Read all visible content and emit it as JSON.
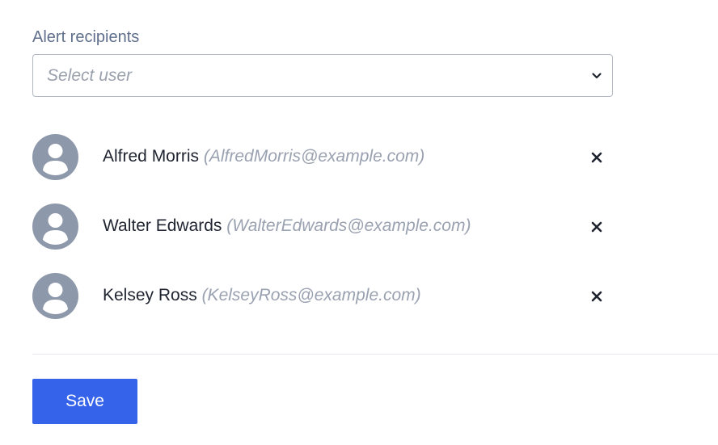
{
  "form": {
    "label": "Alert recipients",
    "select": {
      "placeholder": "Select user",
      "icon": "chevron-down-icon"
    },
    "recipients": [
      {
        "name": "Alfred Morris",
        "email": "(AlfredMorris@example.com)"
      },
      {
        "name": "Walter Edwards",
        "email": "(WalterEdwards@example.com)"
      },
      {
        "name": "Kelsey Ross",
        "email": "(KelseyRoss@example.com)"
      }
    ],
    "remove_icon": "close-icon",
    "avatar_icon": "user-avatar-icon"
  },
  "actions": {
    "save_label": "Save"
  },
  "colors": {
    "primary": "#3563e9",
    "label": "#5f6f8c",
    "avatar": "#8e98ab",
    "email": "#9aa1b0"
  }
}
